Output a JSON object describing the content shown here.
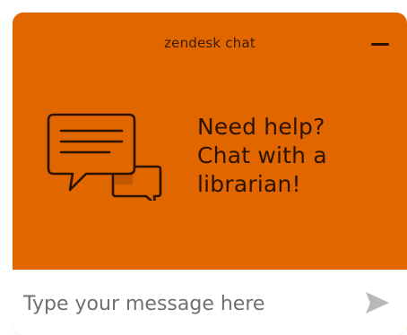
{
  "header": {
    "title": "zendesk chat",
    "minimize_icon": "minimize-icon"
  },
  "greeting": {
    "lines": [
      "Need help?",
      "Chat with a",
      "librarian!"
    ],
    "icon": "chat-bubbles-icon"
  },
  "composer": {
    "placeholder": "Type your message here",
    "value": "",
    "send_icon": "send-icon"
  },
  "colors": {
    "brand": "#e26600",
    "text_dark": "#2b1300",
    "send_icon": "#b8b8b8"
  }
}
